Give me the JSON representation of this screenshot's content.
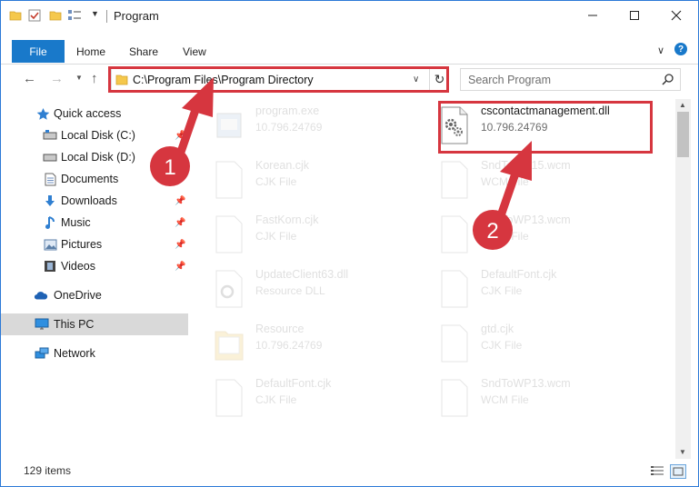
{
  "window": {
    "title": "Program",
    "controls": [
      "minimize",
      "maximize",
      "close"
    ]
  },
  "ribbon": {
    "tabs": [
      "File",
      "Home",
      "Share",
      "View"
    ]
  },
  "address": {
    "path": "C:\\Program Files\\Program Directory"
  },
  "search": {
    "placeholder": "Search Program"
  },
  "sidebar": {
    "items": [
      {
        "label": "Quick access",
        "icon": "star-icon"
      },
      {
        "label": "Local Disk (C:)",
        "icon": "drive-icon"
      },
      {
        "label": "Local Disk (D:)",
        "icon": "drive-icon"
      },
      {
        "label": "Documents",
        "icon": "documents-icon"
      },
      {
        "label": "Downloads",
        "icon": "download-icon"
      },
      {
        "label": "Music",
        "icon": "music-icon"
      },
      {
        "label": "Pictures",
        "icon": "pictures-icon"
      },
      {
        "label": "Videos",
        "icon": "videos-icon"
      },
      {
        "label": "OneDrive",
        "icon": "cloud-icon"
      },
      {
        "label": "This PC",
        "icon": "computer-icon"
      },
      {
        "label": "Network",
        "icon": "network-icon"
      }
    ]
  },
  "files": [
    {
      "name": "program.exe",
      "sub": "10.796.24769"
    },
    {
      "name": "cscontactmanagement.dll",
      "sub": "10.796.24769"
    },
    {
      "name": "Korean.cjk",
      "sub": "CJK File"
    },
    {
      "name": "SndToWP15.wcm",
      "sub": "WCM File"
    },
    {
      "name": "FastKorn.cjk",
      "sub": "CJK File"
    },
    {
      "name": "SndToWP13.wcm",
      "sub": "WCM File"
    },
    {
      "name": "UpdateClient63.dll",
      "sub": "Resource DLL"
    },
    {
      "name": "DefaultFont.cjk",
      "sub": "CJK File"
    },
    {
      "name": "Resource",
      "sub": "10.796.24769"
    },
    {
      "name": "gtd.cjk",
      "sub": "CJK File"
    },
    {
      "name": "DefaultFont.cjk",
      "sub": "CJK File"
    },
    {
      "name": "SndToWP13.wcm",
      "sub": "WCM File"
    }
  ],
  "status": {
    "count": "129 items"
  },
  "annotations": {
    "badge1": "1",
    "badge2": "2"
  },
  "colors": {
    "accent": "#1979ca",
    "highlight": "#d6363f",
    "selected": "#d9d9d9"
  }
}
